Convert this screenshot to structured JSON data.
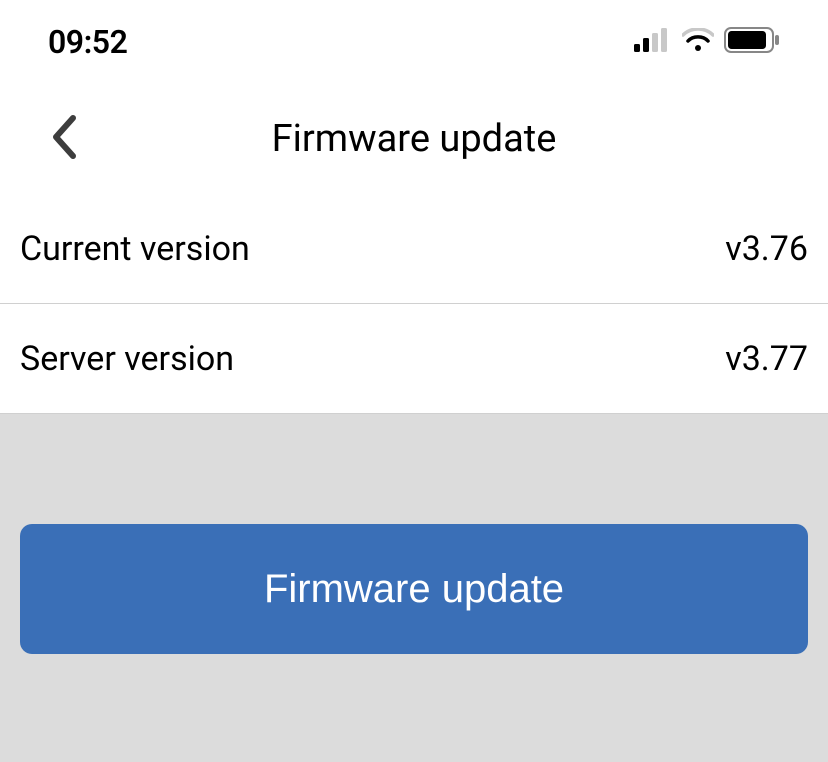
{
  "status_bar": {
    "time": "09:52"
  },
  "header": {
    "title": "Firmware update"
  },
  "rows": [
    {
      "label": "Current version",
      "value": "v3.76"
    },
    {
      "label": "Server version",
      "value": "v3.77"
    }
  ],
  "action": {
    "update_label": "Firmware update"
  },
  "colors": {
    "accent": "#3a6fb7",
    "lower_bg": "#dcdcdc",
    "divider": "#d0d0d0"
  }
}
